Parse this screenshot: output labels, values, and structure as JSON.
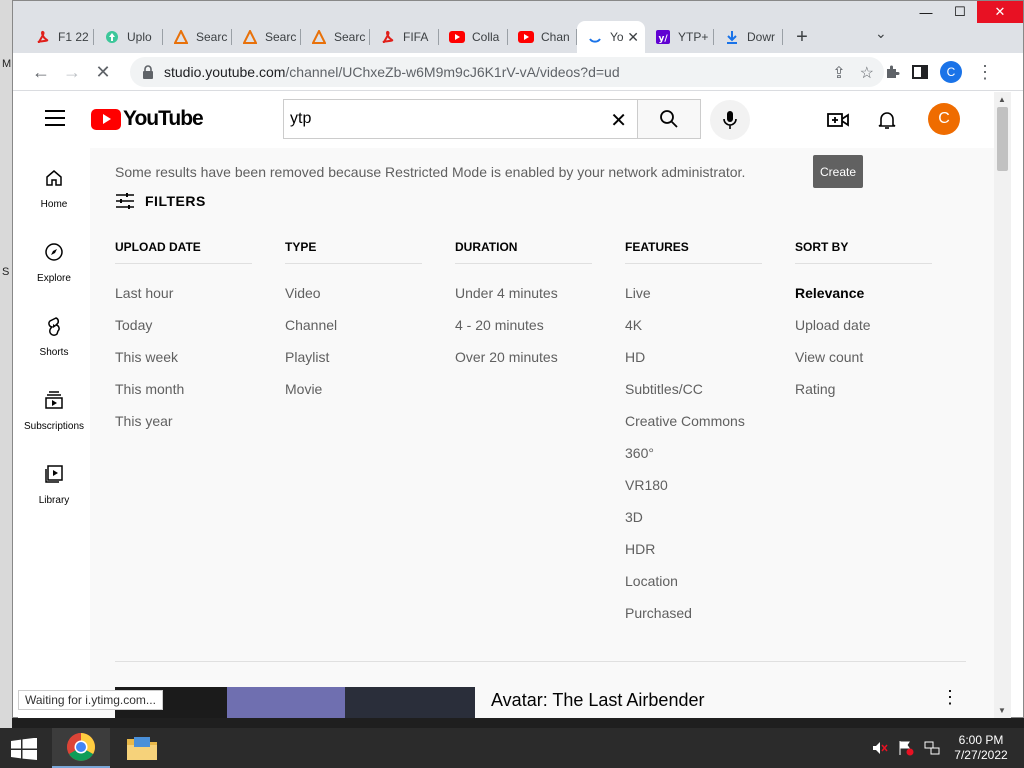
{
  "desktop": {
    "side_letters": [
      "M",
      "S"
    ]
  },
  "browser": {
    "tabs": [
      {
        "label": "F1 22",
        "icon": "acrobat-icon"
      },
      {
        "label": "Uplo",
        "icon": "upload-icon"
      },
      {
        "label": "Searc",
        "icon": "search-site-icon"
      },
      {
        "label": "Searc",
        "icon": "search-site-icon"
      },
      {
        "label": "Searc",
        "icon": "search-site-icon"
      },
      {
        "label": "FIFA",
        "icon": "acrobat-icon"
      },
      {
        "label": "Colla",
        "icon": "youtube-icon"
      },
      {
        "label": "Chan",
        "icon": "youtube-icon"
      },
      {
        "label": "Yo",
        "icon": "loading-icon",
        "active": true
      },
      {
        "label": "YTP+",
        "icon": "yahoo-icon"
      },
      {
        "label": "Dowr",
        "icon": "download-icon"
      }
    ],
    "new_tab": "+",
    "url_host": "studio.youtube.com",
    "url_path": "/channel/UChxeZb-w6M9m9cJ6K1rV-vA/videos?d=ud",
    "profile_initial": "C",
    "status_text": "Waiting for i.ytimg.com..."
  },
  "youtube": {
    "logo_text": "YouTube",
    "search_value": "ytp",
    "avatar_initial": "C",
    "guide": [
      {
        "label": "Home",
        "icon": "home-icon"
      },
      {
        "label": "Explore",
        "icon": "compass-icon"
      },
      {
        "label": "Shorts",
        "icon": "shorts-icon"
      },
      {
        "label": "Subscriptions",
        "icon": "subscriptions-icon"
      },
      {
        "label": "Library",
        "icon": "library-icon"
      }
    ],
    "notice": "Some results have been removed because Restricted Mode is enabled by your network administrator.",
    "tooltip": "Create",
    "filters_label": "FILTERS",
    "filter_columns": [
      {
        "head": "UPLOAD DATE",
        "items": [
          "Last hour",
          "Today",
          "This week",
          "This month",
          "This year"
        ]
      },
      {
        "head": "TYPE",
        "items": [
          "Video",
          "Channel",
          "Playlist",
          "Movie"
        ]
      },
      {
        "head": "DURATION",
        "items": [
          "Under 4 minutes",
          "4 - 20 minutes",
          "Over 20 minutes"
        ]
      },
      {
        "head": "FEATURES",
        "items": [
          "Live",
          "4K",
          "HD",
          "Subtitles/CC",
          "Creative Commons",
          "360°",
          "VR180",
          "3D",
          "HDR",
          "Location",
          "Purchased"
        ]
      },
      {
        "head": "SORT BY",
        "items": [
          "Relevance",
          "Upload date",
          "View count",
          "Rating"
        ],
        "selected": "Relevance"
      }
    ],
    "first_result_title": "Avatar: The Last Airbender"
  },
  "taskbar": {
    "time": "6:00 PM",
    "date": "7/27/2022"
  }
}
